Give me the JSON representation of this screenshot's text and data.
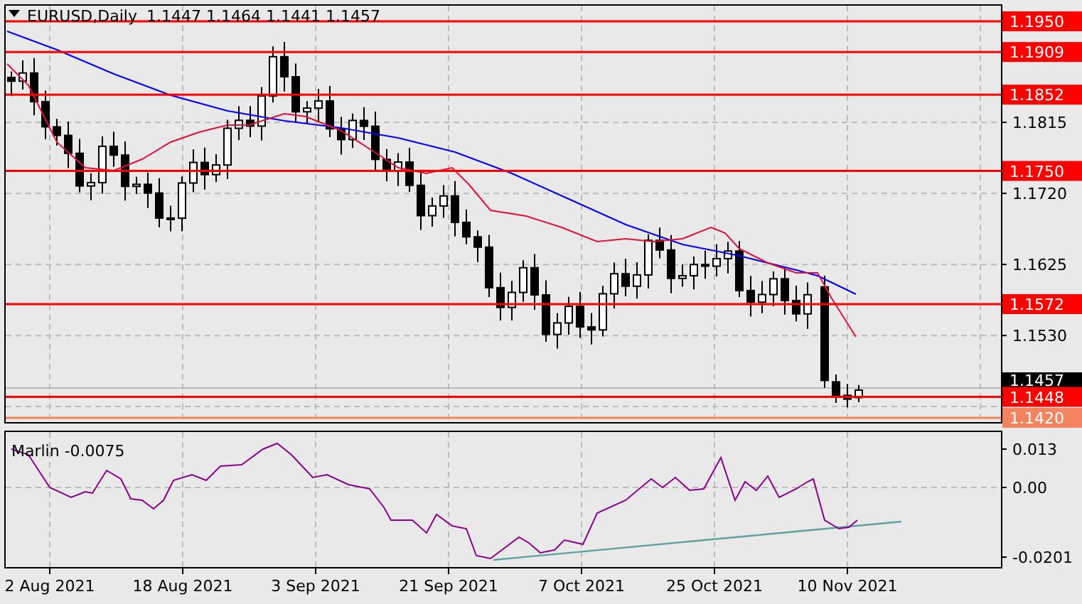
{
  "header": {
    "symbol": "EURUSD,Daily",
    "ohlc": "1.1447 1.1464 1.1441 1.1457"
  },
  "price_axis": {
    "ticks": [
      "1.1815",
      "1.1720",
      "1.1625",
      "1.1530"
    ],
    "levels": [
      {
        "label": "1.1950",
        "color": "#ff0000"
      },
      {
        "label": "1.1909",
        "color": "#ff0000"
      },
      {
        "label": "1.1852",
        "color": "#ff0000"
      },
      {
        "label": "1.1750",
        "color": "#ff0000"
      },
      {
        "label": "1.1572",
        "color": "#ff0000"
      },
      {
        "label": "1.1448",
        "color": "#ff0000"
      },
      {
        "label": "1.1420",
        "color": "#f4845f"
      }
    ],
    "current_price": "1.1457"
  },
  "indicator": {
    "title": "Marlin -0.0075",
    "ticks": [
      "0.013",
      "0.00",
      "-0.0201"
    ]
  },
  "time_axis": {
    "labels": [
      "2 Aug 2021",
      "18 Aug 2021",
      "3 Sep 2021",
      "21 Sep 2021",
      "7 Oct 2021",
      "25 Oct 2021",
      "10 Nov 2021"
    ]
  }
}
